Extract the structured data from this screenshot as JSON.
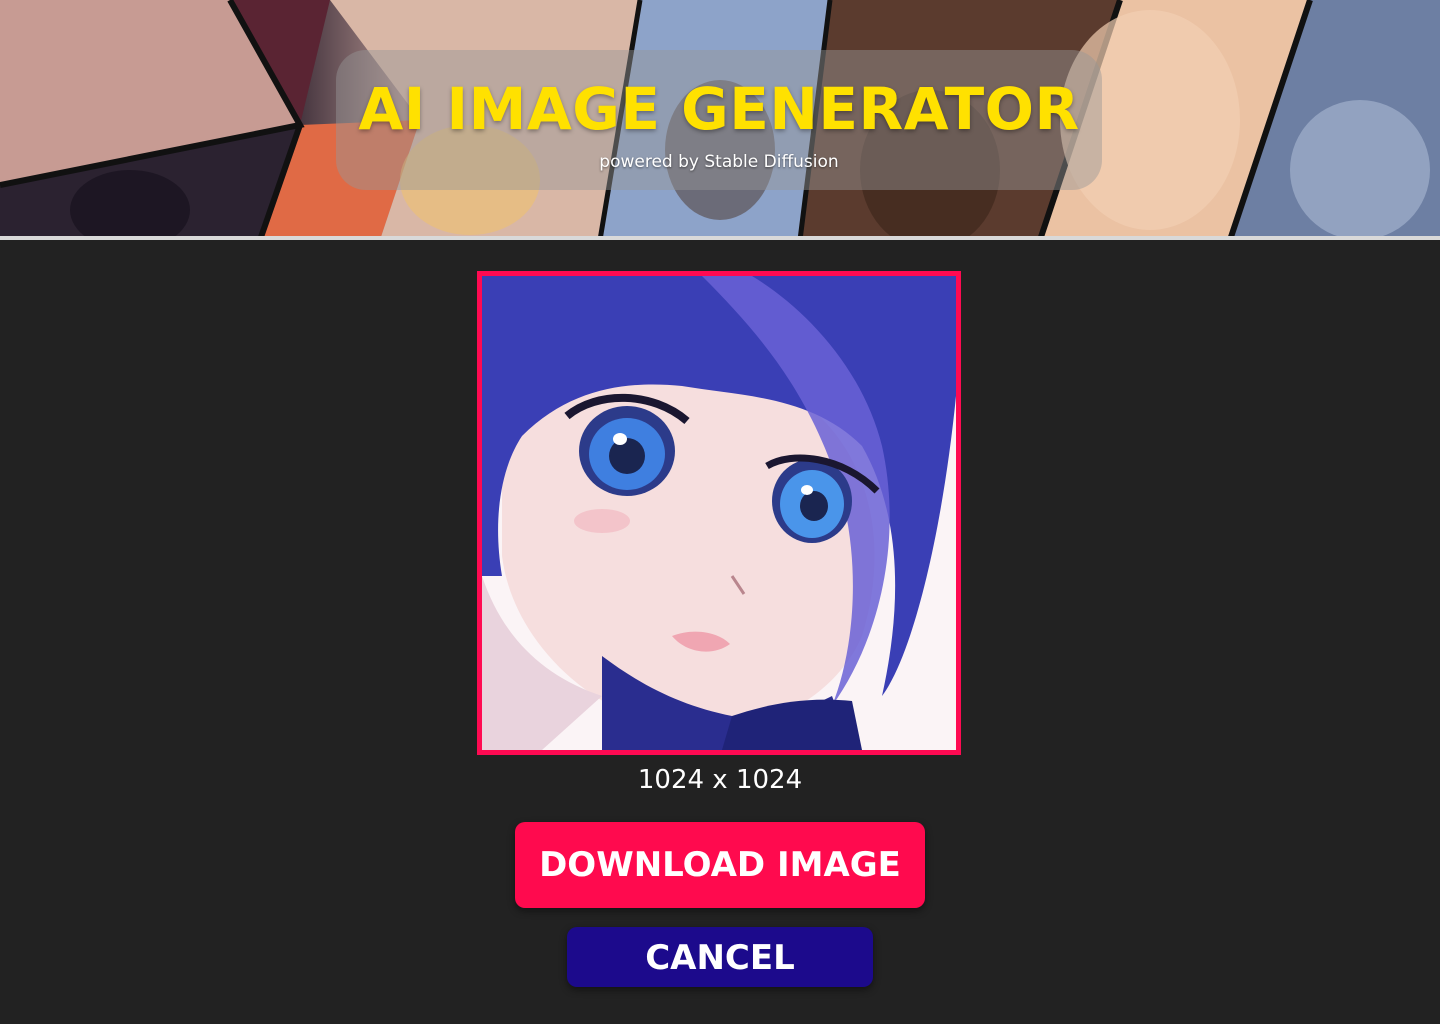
{
  "header": {
    "title": "AI IMAGE GENERATOR",
    "subtitle": "powered by Stable Diffusion"
  },
  "preview": {
    "dimensions_label": "1024 x 1024"
  },
  "actions": {
    "download_label": "DOWNLOAD IMAGE",
    "cancel_label": "CANCEL"
  },
  "colors": {
    "background": "#222222",
    "title_accent": "#ffe100",
    "download_button": "#ff0a4e",
    "cancel_button": "#1c0a8c",
    "image_border": "#ff0a52"
  }
}
